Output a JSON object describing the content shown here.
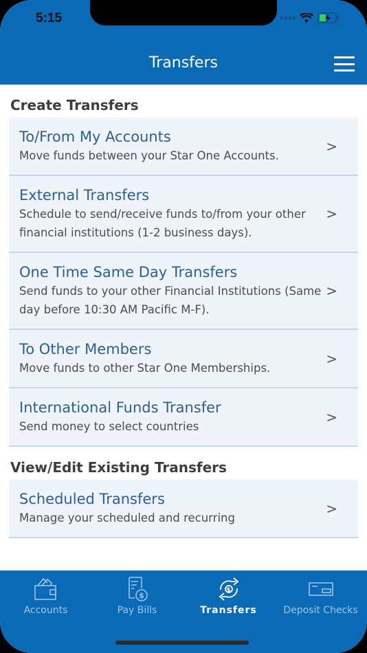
{
  "status_bar": {
    "time": "5:15",
    "icons": [
      "signal-icon",
      "wifi-icon",
      "battery-charging-icon"
    ]
  },
  "header": {
    "title": "Transfers",
    "menu_icon": "hamburger-menu-icon"
  },
  "sections": [
    {
      "title": "Create Transfers",
      "items": [
        {
          "title": "To/From My Accounts",
          "desc": "Move funds between your Star One Accounts."
        },
        {
          "title": "External Transfers",
          "desc": "Schedule to send/receive funds to/from your other financial institutions (1-2 business days)."
        },
        {
          "title": "One Time Same Day Transfers",
          "desc": "Send funds to your other Financial Institutions (Same day before 10:30 AM Pacific M-F)."
        },
        {
          "title": "To Other Members",
          "desc": "Move funds to other Star One Memberships."
        },
        {
          "title": "International Funds Transfer",
          "desc": "Send money to select countries"
        }
      ]
    },
    {
      "title": "View/Edit Existing Transfers",
      "items": [
        {
          "title": "Scheduled Transfers",
          "desc": "Manage your scheduled and recurring"
        }
      ]
    }
  ],
  "chevron": ">",
  "tabbar": {
    "tabs": [
      {
        "label": "Accounts",
        "icon": "wallet-icon",
        "active": false
      },
      {
        "label": "Pay Bills",
        "icon": "bill-dollar-icon",
        "active": false
      },
      {
        "label": "Transfers",
        "icon": "transfer-arrows-icon",
        "active": true
      },
      {
        "label": "Deposit Checks",
        "icon": "check-icon",
        "active": false
      }
    ]
  },
  "colors": {
    "brand": "#0a6ab6",
    "item_bg": "#eef4fa",
    "item_title": "#2d5f90"
  }
}
